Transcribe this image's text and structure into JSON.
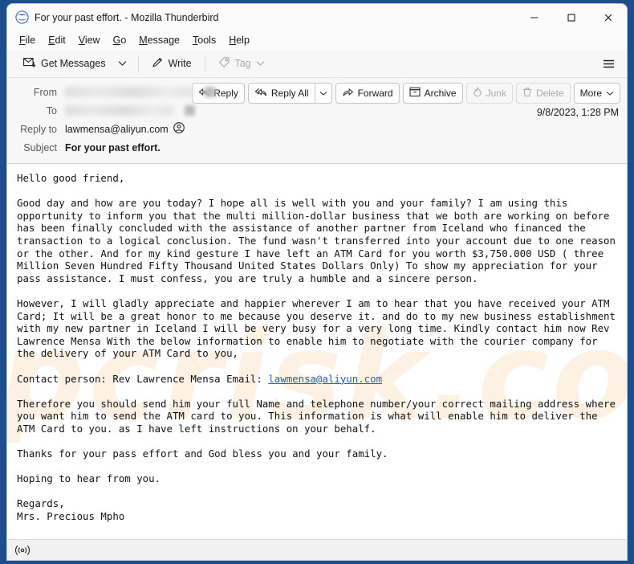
{
  "window": {
    "title": "For your past effort. - Mozilla Thunderbird",
    "app_icon": "thunderbird-icon",
    "controls": {
      "minimize": "minimize",
      "maximize": "maximize",
      "close": "close"
    }
  },
  "menubar": {
    "items": [
      {
        "label": "File",
        "accel": "F"
      },
      {
        "label": "Edit",
        "accel": "E"
      },
      {
        "label": "View",
        "accel": "V"
      },
      {
        "label": "Go",
        "accel": "G"
      },
      {
        "label": "Message",
        "accel": "M"
      },
      {
        "label": "Tools",
        "accel": "T"
      },
      {
        "label": "Help",
        "accel": "H"
      }
    ]
  },
  "toolbar": {
    "get_messages_label": "Get Messages",
    "get_messages_icon": "envelope-download-icon",
    "get_messages_chevron": "chevron-down-icon",
    "write_label": "Write",
    "write_icon": "pencil-icon",
    "tag_label": "Tag",
    "tag_icon": "tag-icon",
    "tag_chevron": "chevron-down-icon",
    "app_menu_icon": "hamburger-menu-icon"
  },
  "message_header": {
    "fields": {
      "from_label": "From",
      "from_value": "",
      "to_label": "To",
      "to_value": "",
      "reply_to_label": "Reply to",
      "reply_to_value": "lawmensa@aliyun.com",
      "reply_to_icon": "contact-person-icon",
      "subject_label": "Subject",
      "subject_value": "For your past effort."
    },
    "date": "9/8/2023, 1:28 PM",
    "actions": [
      {
        "name": "reply",
        "label": "Reply",
        "icon": "reply-arrow-icon",
        "disabled": false
      },
      {
        "name": "reply-all",
        "label": "Reply All",
        "icon": "reply-all-arrow-icon",
        "disabled": false
      },
      {
        "name": "reply-all-dropdown",
        "label": "",
        "icon": "chevron-down-icon",
        "disabled": false
      },
      {
        "name": "forward",
        "label": "Forward",
        "icon": "forward-arrow-icon",
        "disabled": false
      },
      {
        "name": "archive",
        "label": "Archive",
        "icon": "archive-box-icon",
        "disabled": false
      },
      {
        "name": "junk",
        "label": "Junk",
        "icon": "flame-icon",
        "disabled": true
      },
      {
        "name": "delete",
        "label": "Delete",
        "icon": "trash-icon",
        "disabled": true
      },
      {
        "name": "more",
        "label": "More",
        "icon": "chevron-down-icon",
        "disabled": false
      }
    ]
  },
  "message_body": {
    "watermark_text": "pcrisk.com",
    "contact_email": "lawmensa@aliyun.com",
    "part1": "Hello good friend,\n\nGood day and how are you today? I hope all is well with you and your family? I am using this\nopportunity to inform you that the multi million-dollar business that we both are working on before\nhas been finally concluded with the assistance of another partner from Iceland who financed the\ntransaction to a logical conclusion. The fund wasn't transferred into your account due to one reason\nor the other. And for my kind gesture I have left an ATM Card for you worth $3,750.000 USD ( three\nMillion Seven Hundred Fifty Thousand United States Dollars Only) To show my appreciation for your\npass assistance. I must confess, you are truly a humble and a sincere person.\n\nHowever, I will gladly appreciate and happier wherever I am to hear that you have received your ATM\nCard; It will be a great honor to me because you deserve it. and do to my new business establishment\nwith my new partner in Iceland I will be very busy for a very long time. Kindly contact him now Rev\nLawrence Mensa With the below information to enable him to negotiate with the courier company for\nthe delivery of your ATM Card to you,\n\nContact person: Rev Lawrence Mensa Email: ",
    "part2": "\n\nTherefore you should send him your full Name and telephone number/your correct mailing address where\nyou want him to send the ATM card to you. This information is what will enable him to deliver the\nATM Card to you. as I have left instructions on your behalf.\n\nThanks for your pass effort and God bless you and your family.\n\nHoping to hear from you.\n\nRegards,\nMrs. Precious Mpho"
  },
  "statusbar": {
    "icon": "broadcast-signal-icon",
    "text": ""
  },
  "colors": {
    "link": "#2a58c8",
    "accent": "#1b4d8f",
    "watermark": "#fdf1e2"
  }
}
